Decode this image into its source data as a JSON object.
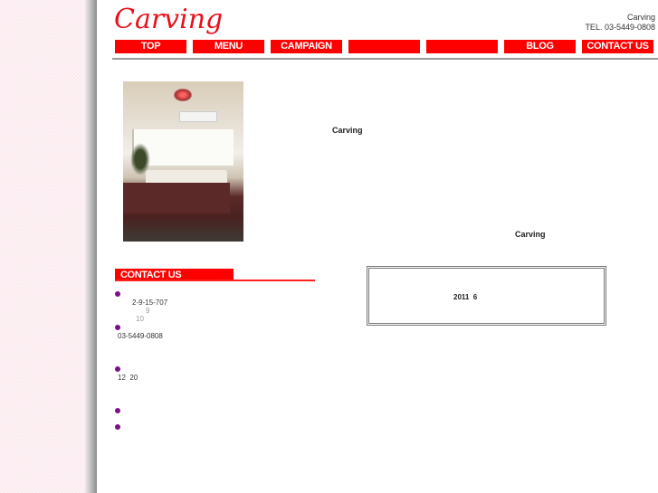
{
  "header": {
    "logo": "Carving",
    "shop_name": "Carving",
    "tel": "TEL. 03-5449-0808"
  },
  "nav": [
    {
      "label": "TOP"
    },
    {
      "label": "MENU"
    },
    {
      "label": "CAMPAIGN"
    },
    {
      "label": ""
    },
    {
      "label": ""
    },
    {
      "label": "BLOG"
    },
    {
      "label": "CONTACT US"
    }
  ],
  "main": {
    "photo_alt": "salon-room-photo",
    "intro_title": "Carving",
    "intro_signature": "Carving"
  },
  "contact": {
    "heading": "CONTACT US",
    "address": "2-9-15-707",
    "address_note1": "9",
    "address_note2": "10",
    "phone": "03-5449-0808",
    "hours": "12  20"
  },
  "notice": {
    "text": "2011  6"
  },
  "colors": {
    "accent": "#ff0000",
    "bullet": "#7a1086"
  }
}
